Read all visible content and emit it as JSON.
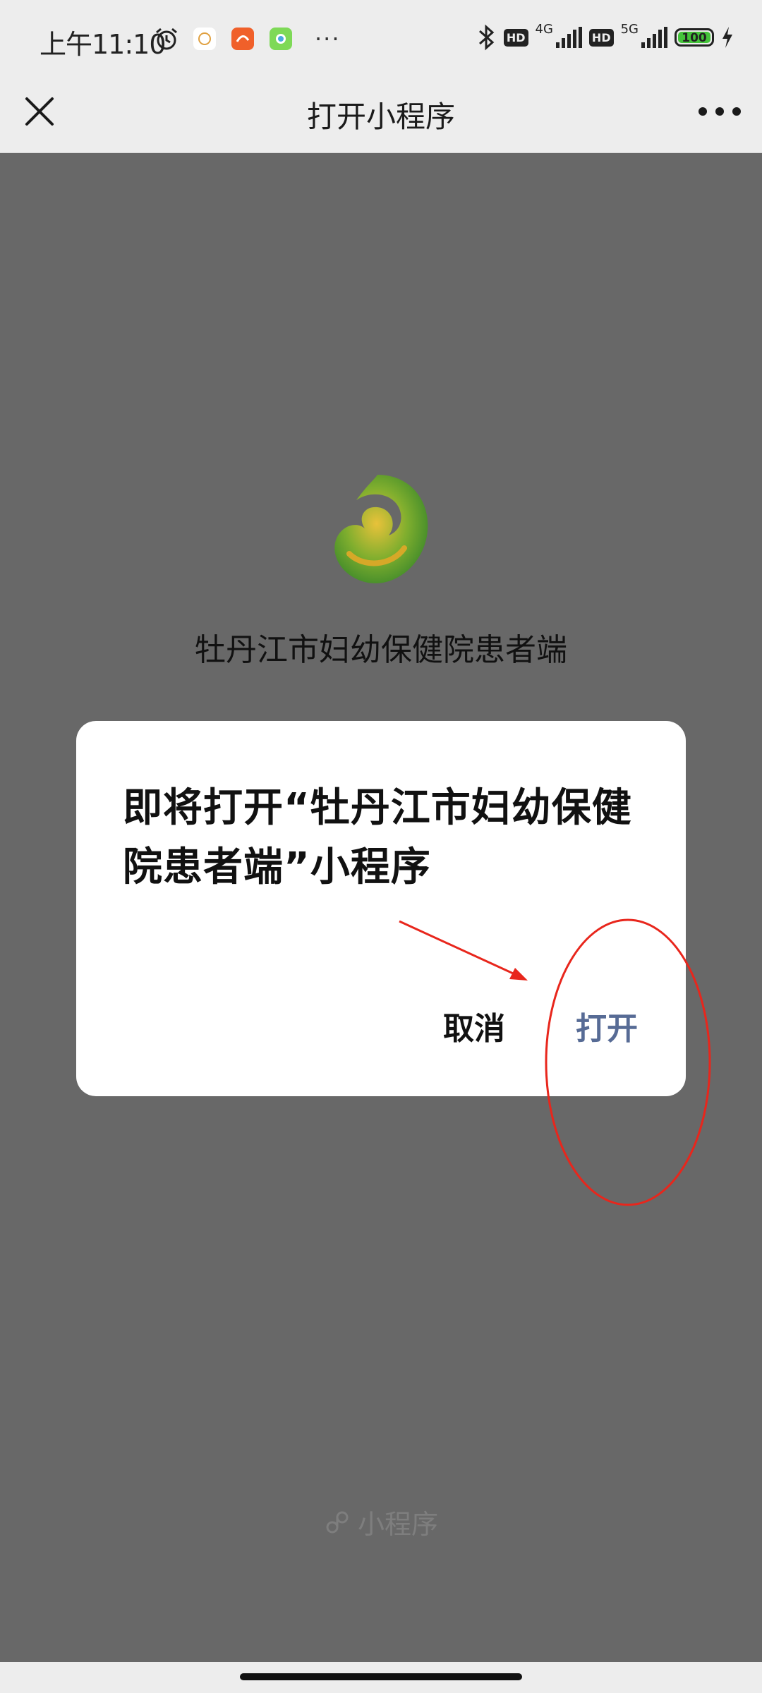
{
  "status_bar": {
    "time": "上午11:10",
    "left_icons": [
      "alarm-icon",
      "app-icon-white",
      "app-icon-orange",
      "app-icon-green"
    ],
    "more": "···",
    "hd1": "HD",
    "net1": "4G",
    "hd2": "HD",
    "net2": "5G",
    "battery": "100"
  },
  "title_bar": {
    "title": "打开小程序"
  },
  "background": {
    "app_name": "牡丹江市妇幼保健院患者端",
    "footer_label": "小程序"
  },
  "dialog": {
    "message": "即将打开“牡丹江市妇幼保健院患者端”小程序",
    "cancel_label": "取消",
    "open_label": "打开"
  },
  "colors": {
    "accent_link": "#576b95",
    "overlay": "#686868",
    "annotation_red": "#e8261c",
    "battery_green": "#44c33a"
  }
}
